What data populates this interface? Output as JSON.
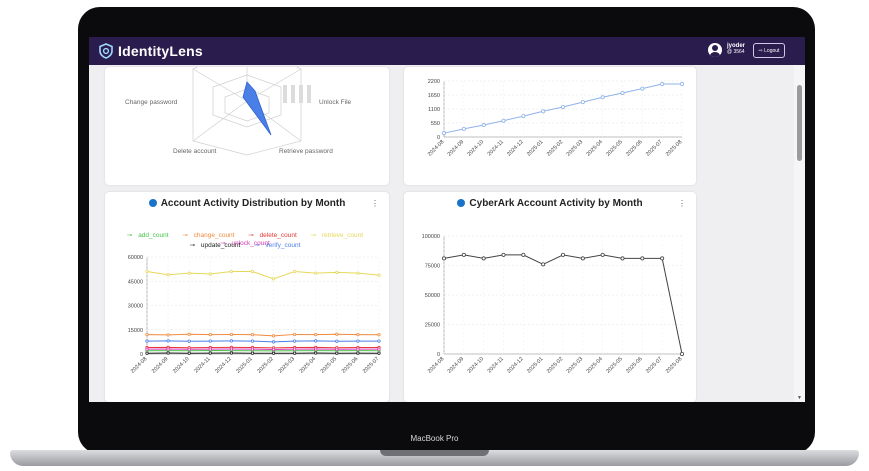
{
  "device": {
    "model_label": "MacBook Pro"
  },
  "app": {
    "brand": "IdentityLens"
  },
  "user": {
    "name": "jyoder",
    "sub": "@ 3564"
  },
  "logout_label": "⇨ Logout",
  "colors": {
    "topbar": "#2a1c4d",
    "accent": "#1a73c9"
  },
  "radar": {
    "labels": [
      "Change password",
      "Unlock File",
      "Delete account",
      "Retrieve password"
    ]
  },
  "charts": {
    "top_right": {
      "title": "",
      "chart_data": {
        "type": "line",
        "categories": [
          "2024-08",
          "2024-09",
          "2024-10",
          "2024-11",
          "2024-12",
          "2025-01",
          "2025-02",
          "2025-03",
          "2025-04",
          "2025-05",
          "2025-06",
          "2025-07",
          "2025-08"
        ],
        "series": [
          {
            "values": [
              150,
              320,
              470,
              640,
              820,
              1010,
              1180,
              1370,
              1560,
              1730,
              1900,
              2080,
              2080
            ]
          }
        ],
        "y_ticks": [
          0,
          550,
          1100,
          1650,
          2200
        ],
        "ylim": [
          0,
          2200
        ],
        "grid": true
      }
    },
    "bottom_left": {
      "title": "Account Activity Distribution by Month",
      "menu": "⋮",
      "chart_data": {
        "type": "line",
        "categories": [
          "2024-08",
          "2024-09",
          "2024-10",
          "2024-11",
          "2024-12",
          "2025-01",
          "2025-02",
          "2025-03",
          "2025-04",
          "2025-05",
          "2025-06",
          "2025-07"
        ],
        "y_ticks": [
          0,
          15000,
          30000,
          45000,
          60000
        ],
        "ylim": [
          0,
          60000
        ],
        "series": [
          {
            "name": "add_count",
            "color": "#49c24a",
            "values": [
              2000,
              2100,
              2000,
              2200,
              2100,
              2000,
              1900,
              2000,
              2100,
              2000,
              2100,
              2000
            ]
          },
          {
            "name": "change_count",
            "color": "#f08a3c",
            "values": [
              12000,
              11800,
              12200,
              12000,
              12100,
              12000,
              11200,
              12100,
              12000,
              12200,
              12000,
              11900
            ]
          },
          {
            "name": "delete_count",
            "color": "#e53935",
            "values": [
              4000,
              4100,
              3900,
              4000,
              4100,
              4000,
              3800,
              4000,
              4100,
              3900,
              4000,
              4000
            ]
          },
          {
            "name": "retrieve_count",
            "color": "#e6d85a",
            "values": [
              51000,
              49000,
              50000,
              49500,
              51000,
              51000,
              46500,
              51000,
              50000,
              50500,
              50000,
              48800
            ]
          },
          {
            "name": "unlock_count",
            "color": "#d63bb5",
            "values": [
              3000,
              3100,
              2900,
              3000,
              3100,
              3000,
              2800,
              3000,
              3100,
              2900,
              3000,
              3000
            ]
          },
          {
            "name": "update_count",
            "color": "#1f1f1f",
            "values": [
              500,
              600,
              500,
              550,
              600,
              500,
              450,
              500,
              600,
              500,
              550,
              500
            ]
          },
          {
            "name": "verify_count",
            "color": "#4a7fe8",
            "values": [
              8000,
              8100,
              7900,
              8000,
              8100,
              8000,
              7500,
              8000,
              8100,
              7900,
              8000,
              8000
            ]
          }
        ],
        "grid": true,
        "legend": "top"
      }
    },
    "bottom_right": {
      "title": "CyberArk Account Activity by Month",
      "menu": "⋮",
      "chart_data": {
        "type": "line",
        "categories": [
          "2024-08",
          "2024-09",
          "2024-10",
          "2024-11",
          "2024-12",
          "2025-01",
          "2025-02",
          "2025-03",
          "2025-04",
          "2025-05",
          "2025-06",
          "2025-07",
          "2025-08"
        ],
        "series": [
          {
            "values": [
              81000,
              84000,
              81000,
              84000,
              84000,
              76000,
              84000,
              81000,
              84000,
              81000,
              81000,
              81000,
              0
            ]
          }
        ],
        "y_ticks": [
          0,
          25000,
          50000,
          75000,
          100000
        ],
        "ylim": [
          0,
          100000
        ],
        "grid": true
      }
    }
  }
}
